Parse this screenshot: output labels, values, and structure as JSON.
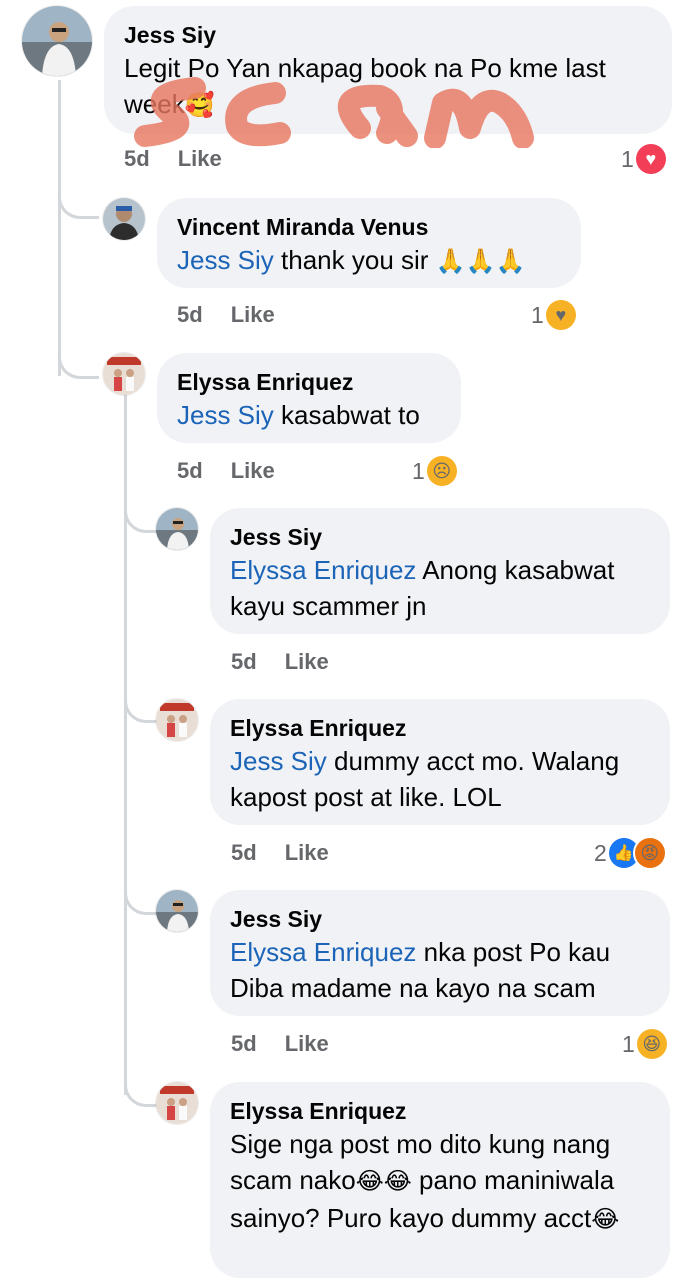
{
  "colors": {
    "mention": "#1b64b7",
    "bubble": "#f0f2f5",
    "meta": "#65676b",
    "thread_line": "#d3d6db"
  },
  "overlay": {
    "text": "scam",
    "color": "#e8765f"
  },
  "comments": [
    {
      "author": "Jess Siy",
      "text": "Legit Po Yan nkapag book na Po kme last week",
      "emoji_after": "🥰",
      "time": "5d",
      "like": "Like",
      "reaction_count": "1",
      "reaction_icons": [
        "heart-icon"
      ]
    },
    {
      "author": "Vincent Miranda Venus",
      "mention": "Jess Siy",
      "text": " thank you sir ",
      "emoji_after": "🙏🙏🙏",
      "time": "5d",
      "like": "Like",
      "reaction_count": "1",
      "reaction_icons": [
        "care-icon"
      ]
    },
    {
      "author": "Elyssa Enriquez",
      "mention": "Jess Siy",
      "text": " kasabwat to",
      "time": "5d",
      "like": "Like",
      "reaction_count": "1",
      "reaction_icons": [
        "sad-icon"
      ]
    },
    {
      "author": "Jess Siy",
      "mention": "Elyssa Enriquez",
      "text": " Anong kasabwat kayu scammer jn",
      "time": "5d",
      "like": "Like"
    },
    {
      "author": "Elyssa Enriquez",
      "mention": "Jess Siy",
      "text": " dummy acct mo. Walang kapost post at like. LOL",
      "time": "5d",
      "like": "Like",
      "reaction_count": "2",
      "reaction_icons": [
        "like-icon",
        "angry-icon"
      ]
    },
    {
      "author": "Jess Siy",
      "mention": "Elyssa Enriquez",
      "text": " nka post Po kau Diba madame na kayo na scam",
      "time": "5d",
      "like": "Like",
      "reaction_count": "1",
      "reaction_icons": [
        "haha-icon"
      ]
    },
    {
      "author": "Elyssa Enriquez",
      "text_parts": [
        "Sige nga post mo dito kung nang scam nako",
        "😂😂",
        " pano maniniwala sainyo? Puro kayo dummy acct",
        "😂"
      ]
    }
  ]
}
